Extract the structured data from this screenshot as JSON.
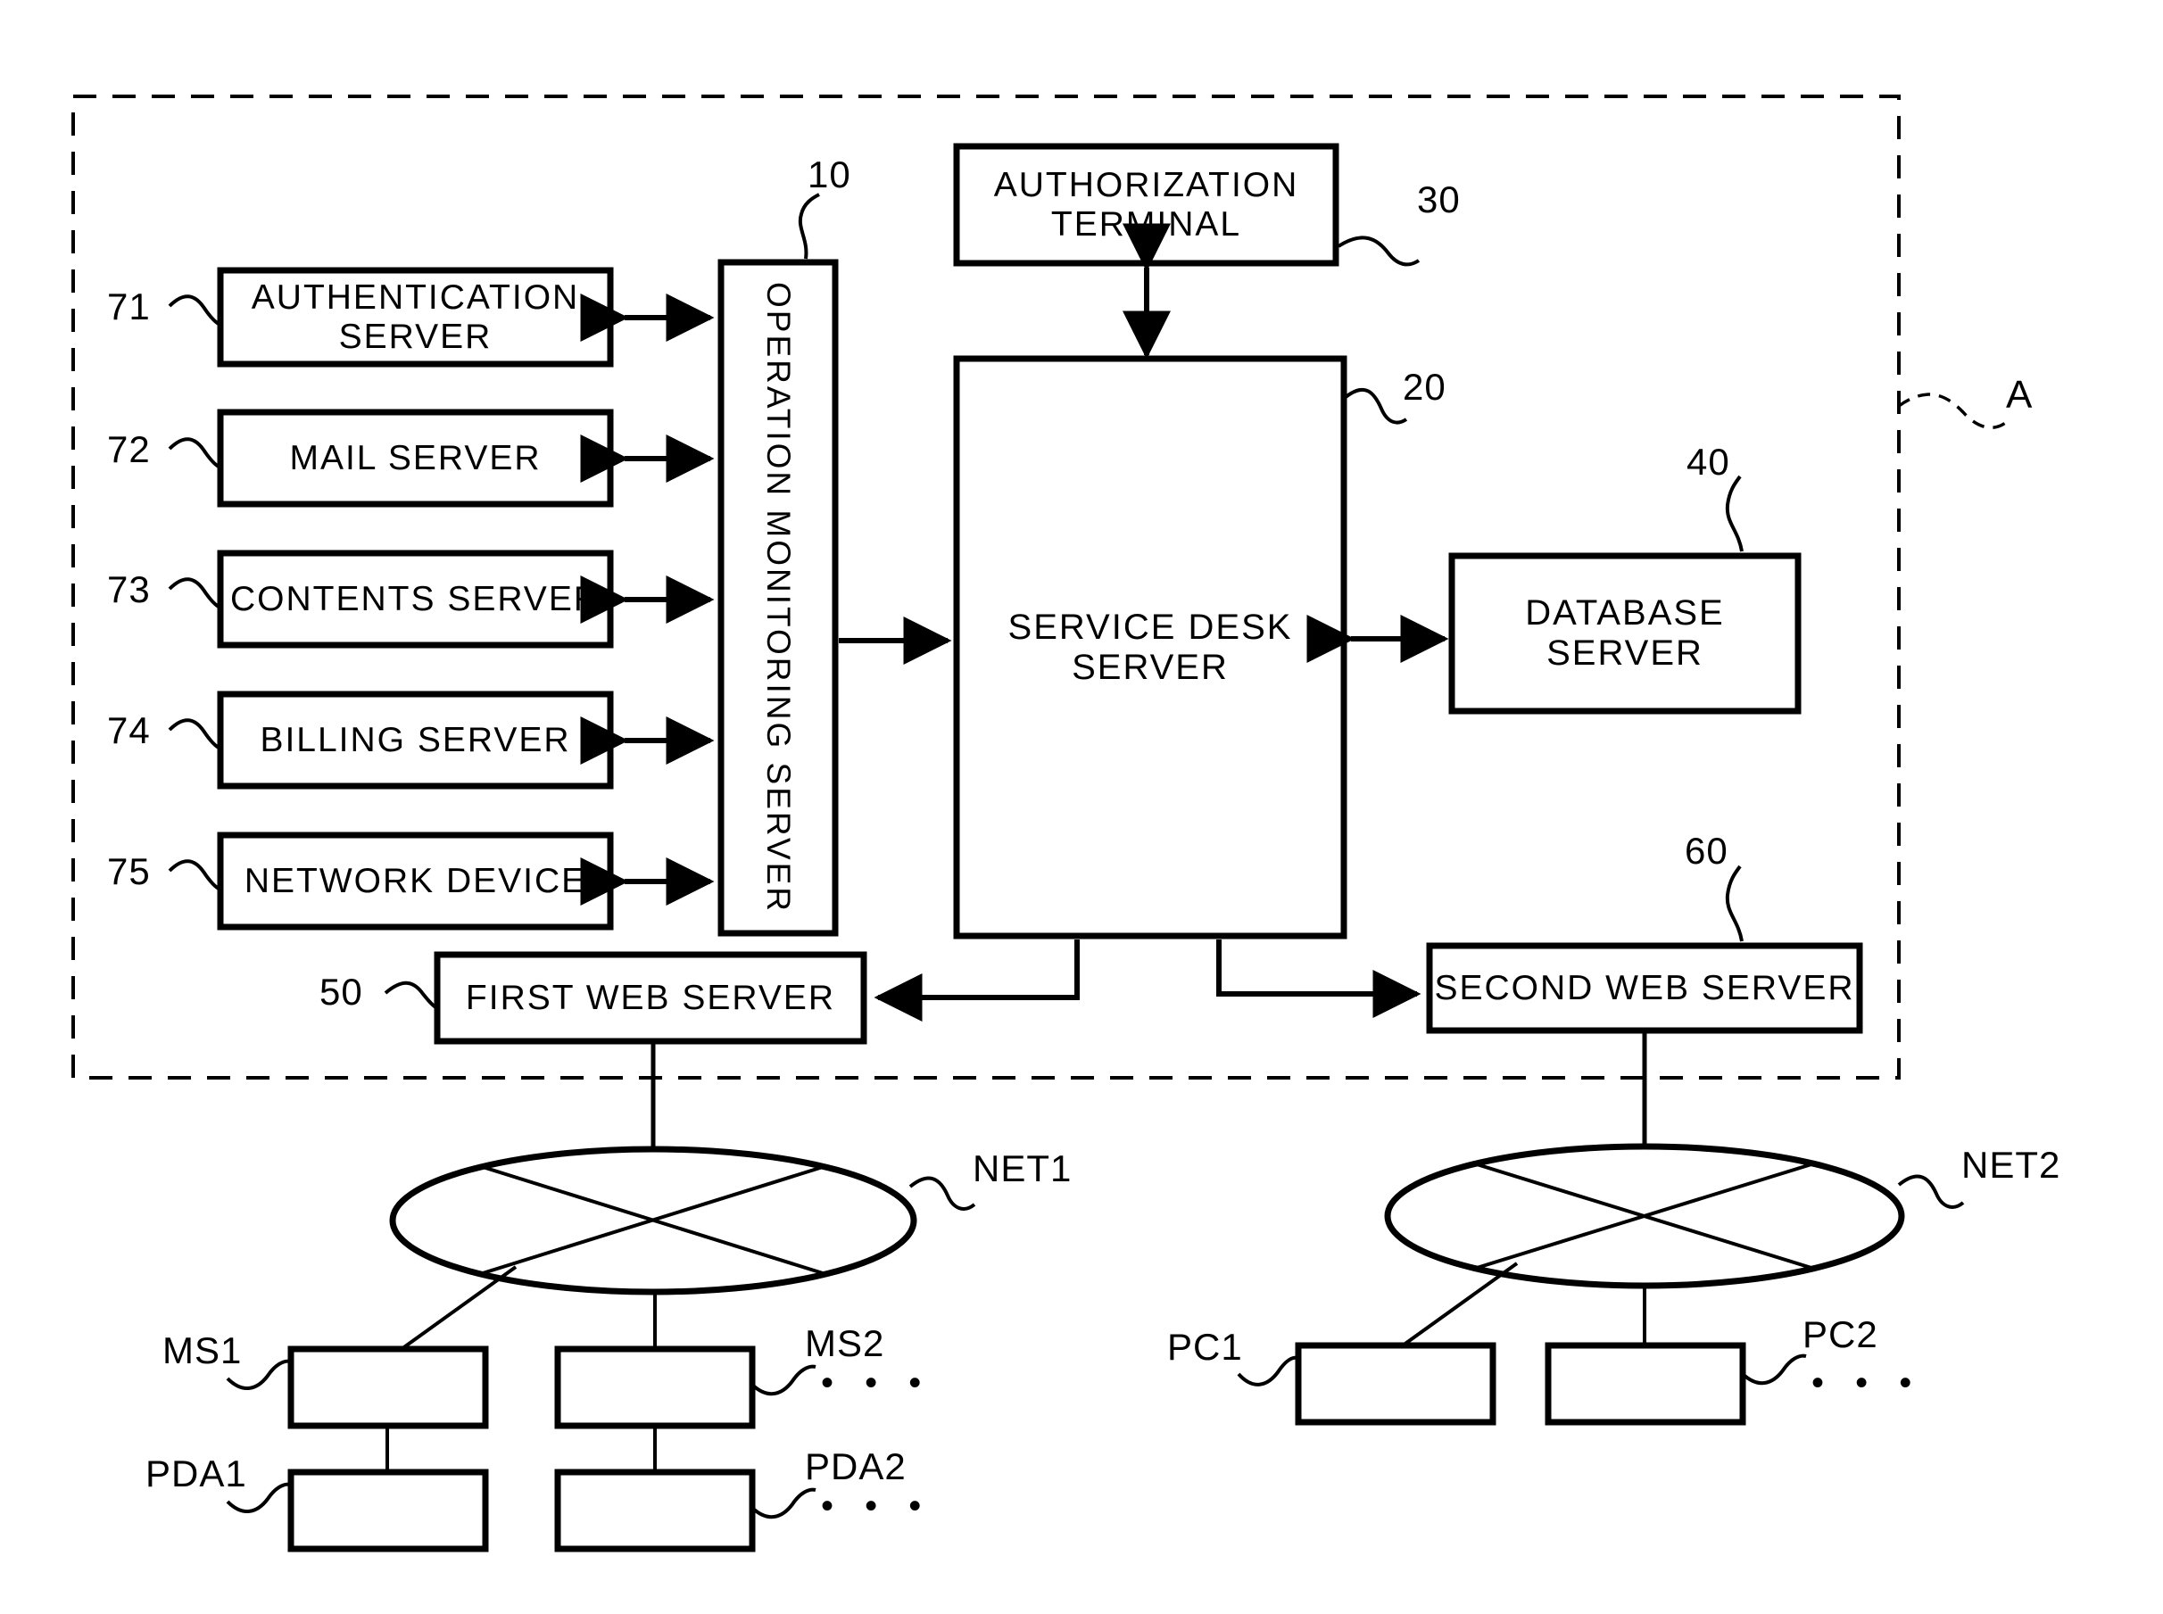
{
  "figure": {
    "domain_boundary_label": "A",
    "type": "patent-block-diagram"
  },
  "system_boundary": {
    "label": "A"
  },
  "monitored_servers": [
    {
      "ref": "71",
      "label": "AUTHENTICATION\nSERVER"
    },
    {
      "ref": "72",
      "label": "MAIL SERVER"
    },
    {
      "ref": "73",
      "label": "CONTENTS SERVER"
    },
    {
      "ref": "74",
      "label": "BILLING SERVER"
    },
    {
      "ref": "75",
      "label": "NETWORK DEVICE"
    }
  ],
  "core_nodes": {
    "operation_monitoring_server": {
      "ref": "10",
      "label": "OPERATION MONITORING SERVER"
    },
    "service_desk_server": {
      "ref": "20",
      "label": "SERVICE DESK\nSERVER"
    },
    "authorization_terminal": {
      "ref": "30",
      "label": "AUTHORIZATION\nTERMINAL"
    },
    "database_server": {
      "ref": "40",
      "label": "DATABASE\nSERVER"
    },
    "first_web_server": {
      "ref": "50",
      "label": "FIRST WEB SERVER"
    },
    "second_web_server": {
      "ref": "60",
      "label": "SECOND WEB SERVER"
    }
  },
  "networks": [
    {
      "ref": "NET1",
      "label": "NET1"
    },
    {
      "ref": "NET2",
      "label": "NET2"
    }
  ],
  "terminals": {
    "net1": [
      {
        "ref": "MS1",
        "label": "MS1"
      },
      {
        "ref": "MS2",
        "label": "MS2"
      },
      {
        "ref": "PDA1",
        "label": "PDA1"
      },
      {
        "ref": "PDA2",
        "label": "PDA2"
      }
    ],
    "net2": [
      {
        "ref": "PC1",
        "label": "PC1"
      },
      {
        "ref": "PC2",
        "label": "PC2"
      }
    ],
    "ellipsis": "• • •"
  },
  "colors": {
    "stroke": "#000000",
    "background": "#ffffff"
  }
}
